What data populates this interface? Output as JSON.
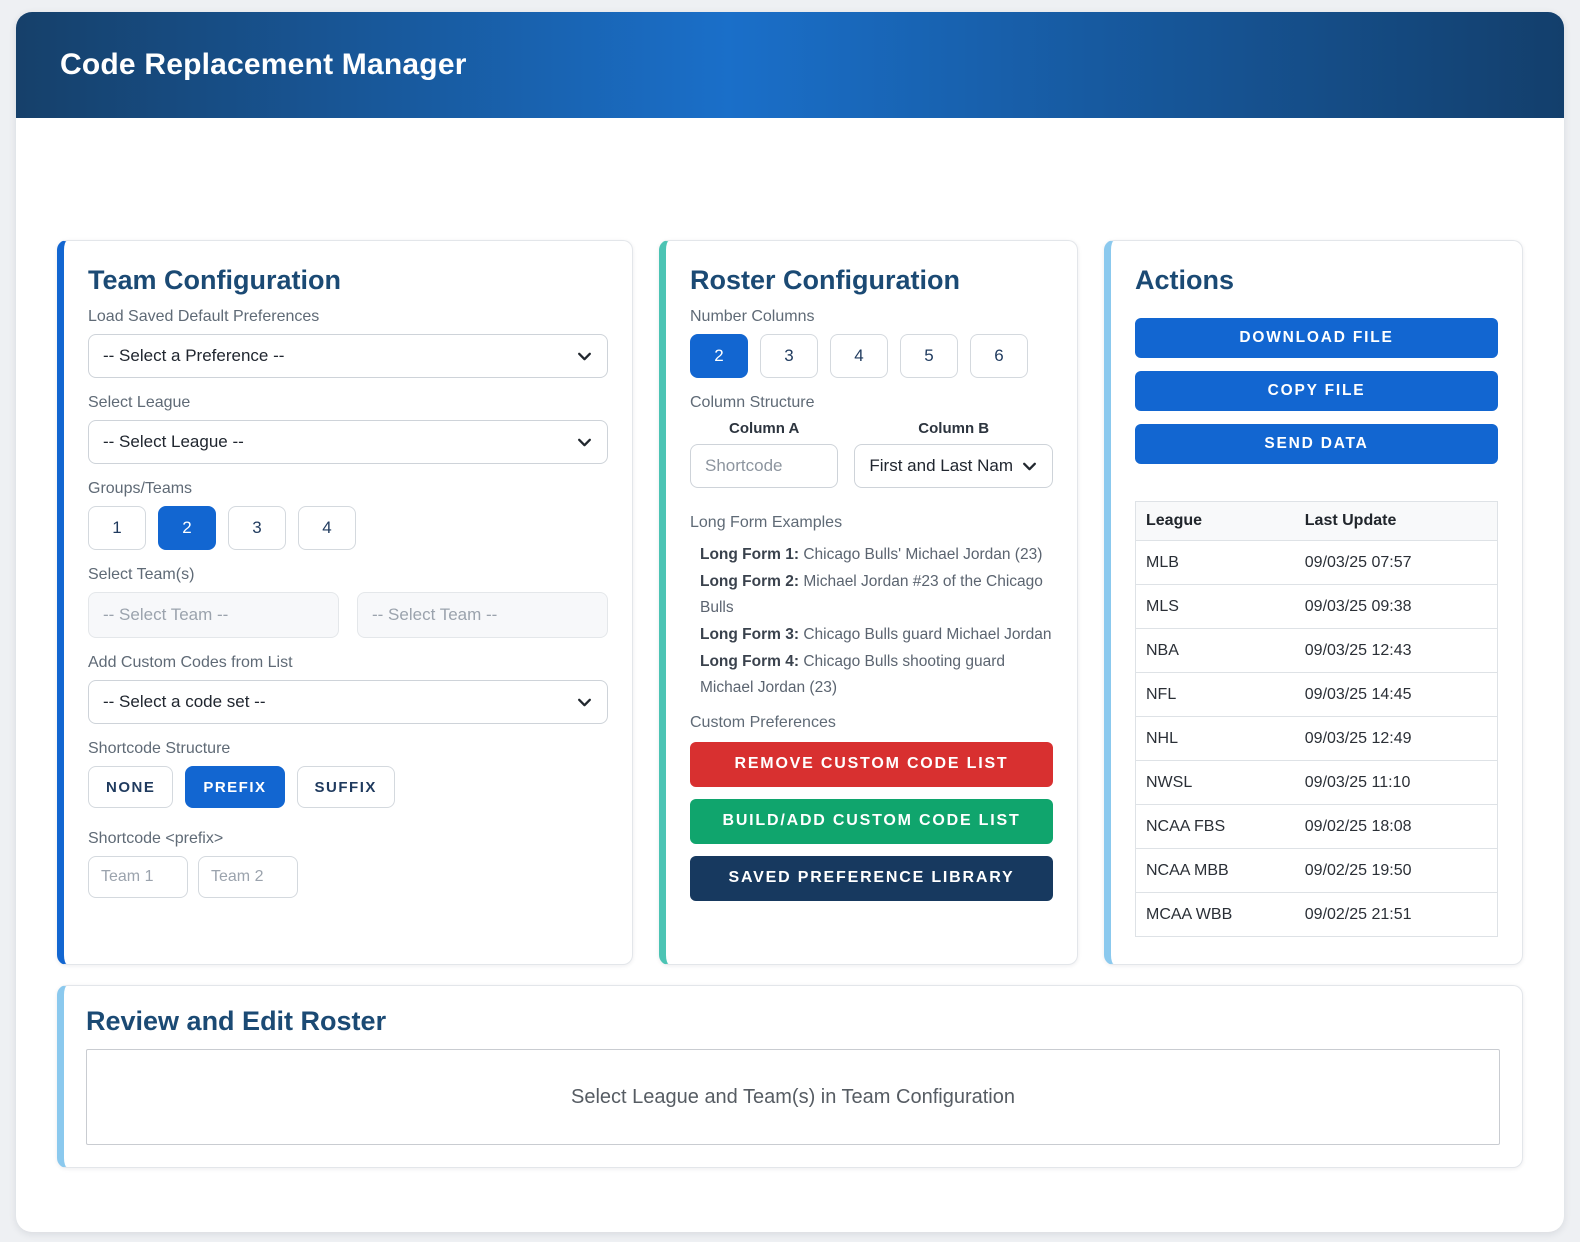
{
  "header": {
    "title": "Code Replacement Manager"
  },
  "team_config": {
    "title": "Team Configuration",
    "load_prefs_label": "Load Saved Default Preferences",
    "pref_select_value": "-- Select a Preference --",
    "league_label": "Select League",
    "league_select_value": "-- Select League --",
    "groups_label": "Groups/Teams",
    "group_options": [
      "1",
      "2",
      "3",
      "4"
    ],
    "group_selected": "2",
    "teams_label": "Select Team(s)",
    "team_placeholders": [
      "-- Select Team --",
      "-- Select Team --"
    ],
    "custom_codes_label": "Add Custom Codes from List",
    "code_set_value": "-- Select a code set --",
    "shortcode_structure_label": "Shortcode Structure",
    "structure_options": [
      "NONE",
      "PREFIX",
      "SUFFIX"
    ],
    "structure_selected": "PREFIX",
    "prefix_label": "Shortcode <prefix>",
    "prefix_placeholders": [
      "Team 1",
      "Team 2"
    ]
  },
  "roster_config": {
    "title": "Roster Configuration",
    "number_columns_label": "Number Columns",
    "column_options": [
      "2",
      "3",
      "4",
      "5",
      "6"
    ],
    "column_selected": "2",
    "column_structure_label": "Column Structure",
    "column_a_label": "Column A",
    "column_a_placeholder": "Shortcode",
    "column_b_label": "Column B",
    "column_b_value": "First and Last Nam",
    "long_form_label": "Long Form Examples",
    "long_forms": [
      {
        "label": "Long Form 1:",
        "text": "Chicago Bulls' Michael Jordan (23)"
      },
      {
        "label": "Long Form 2:",
        "text": "Michael Jordan #23 of the Chicago Bulls"
      },
      {
        "label": "Long Form 3:",
        "text": "Chicago Bulls guard Michael Jordan"
      },
      {
        "label": "Long Form 4:",
        "text": "Chicago Bulls shooting guard Michael Jordan (23)"
      }
    ],
    "custom_prefs_label": "Custom Preferences",
    "buttons": [
      {
        "label": "REMOVE CUSTOM CODE LIST",
        "color": "#d83030"
      },
      {
        "label": "BUILD/ADD CUSTOM CODE LIST",
        "color": "#10a56d"
      },
      {
        "label": "SAVED PREFERENCE LIBRARY",
        "color": "#17395f"
      }
    ]
  },
  "actions": {
    "title": "Actions",
    "buttons": [
      "DOWNLOAD FILE",
      "COPY FILE",
      "SEND DATA"
    ],
    "table": {
      "headers": [
        "League",
        "Last Update"
      ],
      "rows": [
        [
          "MLB",
          "09/03/25 07:57"
        ],
        [
          "MLS",
          "09/03/25 09:38"
        ],
        [
          "NBA",
          "09/03/25 12:43"
        ],
        [
          "NFL",
          "09/03/25 14:45"
        ],
        [
          "NHL",
          "09/03/25 12:49"
        ],
        [
          "NWSL",
          "09/03/25 11:10"
        ],
        [
          "NCAA FBS",
          "09/02/25 18:08"
        ],
        [
          "NCAA MBB",
          "09/02/25 19:50"
        ],
        [
          "MCAA WBB",
          "09/02/25 21:51"
        ]
      ]
    }
  },
  "review": {
    "title": "Review and Edit Roster",
    "empty_message": "Select League and Team(s) in Team Configuration"
  },
  "colors": {
    "primary_blue": "#1266d1",
    "accent_teal": "#4cc4b4",
    "accent_light_blue": "#8bc9ee",
    "danger_red": "#d83030",
    "success_green": "#10a56d",
    "navy": "#17395f",
    "heading_navy": "#1b4a74",
    "header_gradient_start": "#16406a",
    "header_gradient_mid": "#1a6fc9",
    "header_gradient_end": "#133f6c"
  }
}
